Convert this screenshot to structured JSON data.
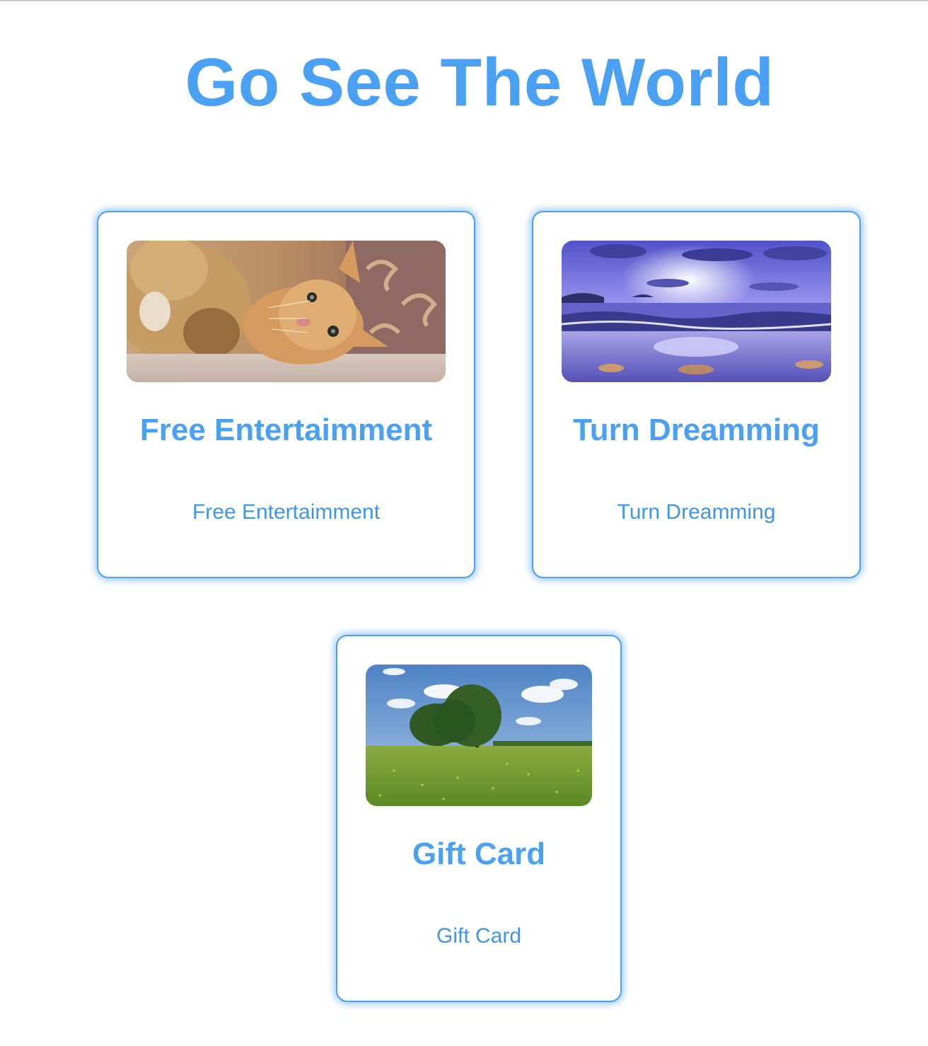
{
  "page": {
    "title": "Go See The World",
    "accent_color": "#4aa1f3"
  },
  "cards": [
    {
      "image_icon": "cat-photo",
      "title": "Free Entertaimment",
      "link_text": "Free Entertaimment"
    },
    {
      "image_icon": "beach-sunset-photo",
      "title": "Turn Dreamming",
      "link_text": "Turn Dreamming"
    },
    {
      "image_icon": "tree-field-photo",
      "title": "Gift Card",
      "link_text": "Gift Card"
    }
  ]
}
